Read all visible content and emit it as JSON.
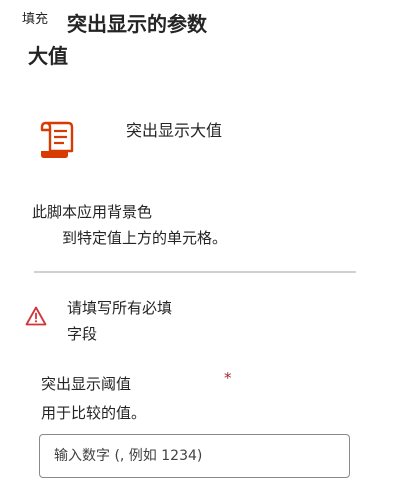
{
  "header": {
    "fill_tag": "填充",
    "title_line1": "突出显示的参数",
    "title_line2": "大值"
  },
  "script": {
    "name": "突出显示大值",
    "icon": "script-scroll-icon",
    "icon_color": "#d83b01"
  },
  "description": {
    "line1": "此脚本应用背景色",
    "line2": "到特定值上方的单元格。"
  },
  "warning": {
    "icon": "warning-triangle-icon",
    "color": "#d13438",
    "line1": "请填写所有必填",
    "line2": "字段"
  },
  "field": {
    "label": "突出显示阈值",
    "required_mark": "*",
    "help": "用于比较的值。",
    "placeholder": "输入数字 (, 例如 1234)",
    "value": ""
  }
}
